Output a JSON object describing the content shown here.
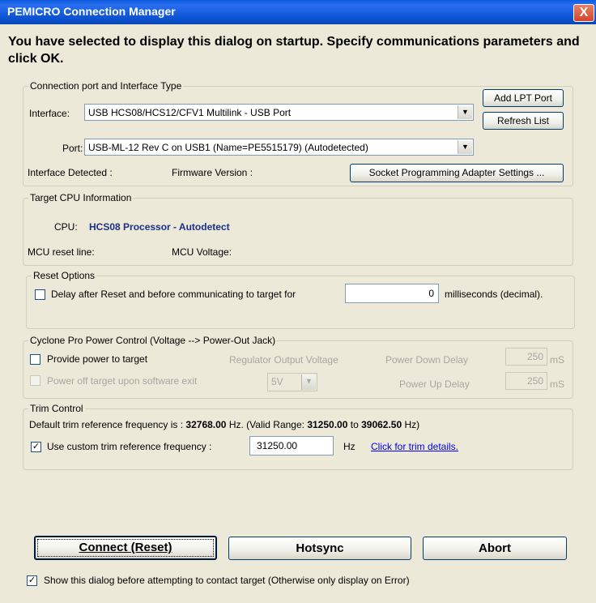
{
  "window": {
    "title": "PEMICRO Connection Manager",
    "close_glyph": "X"
  },
  "intro_text": "You have selected to display this dialog on startup. Specify communications parameters and click OK.",
  "connection": {
    "legend": "Connection port and Interface Type",
    "interface_label": "Interface:",
    "interface_value": "USB HCS08/HCS12/CFV1 Multilink - USB Port",
    "port_label": "Port:",
    "port_value": "USB-ML-12 Rev C on USB1 (Name=PE5515179) (Autodetected)",
    "add_lpt_label": "Add LPT Port",
    "refresh_label": "Refresh List",
    "interface_detected_label": "Interface Detected :",
    "firmware_label": "Firmware Version :",
    "socket_button_label": "Socket Programming Adapter Settings ..."
  },
  "target_cpu": {
    "legend": "Target CPU Information",
    "cpu_label": "CPU:",
    "cpu_value": "HCS08 Processor - Autodetect",
    "reset_line_label": "MCU reset line:",
    "voltage_label": "MCU Voltage:"
  },
  "reset_options": {
    "legend": "Reset Options",
    "delay_label": "Delay after Reset and before communicating to target for",
    "delay_value": "0",
    "delay_unit": "milliseconds (decimal)."
  },
  "power_control": {
    "legend": "Cyclone Pro Power Control  (Voltage --> Power-Out Jack)",
    "provide_power_label": "Provide power to target",
    "regulator_label": "Regulator Output Voltage",
    "power_down_label": "Power Down Delay",
    "power_down_value": "250",
    "power_down_unit": "mS",
    "power_off_label": "Power off target upon software exit",
    "voltage_value": "5V",
    "power_up_label": "Power Up Delay",
    "power_up_value": "250",
    "power_up_unit": "mS"
  },
  "trim": {
    "legend": "Trim Control",
    "default_prefix": "Default trim reference frequency is :",
    "default_value": "32768.00",
    "hz_valid_prefix": "Hz. (Valid Range:",
    "range_min": "31250.00",
    "range_to": "to",
    "range_max": "39062.50",
    "range_suffix": "Hz)",
    "custom_label": "Use custom trim reference frequency :",
    "custom_value": "31250.00",
    "custom_unit": "Hz",
    "details_link": "Click for trim details.",
    "custom_checked": "✓"
  },
  "buttons": {
    "connect_label": "Connect (Reset)",
    "hotsync_label": "Hotsync",
    "abort_label": "Abort"
  },
  "footer": {
    "show_dialog_label": "Show this dialog before attempting to contact target (Otherwise only display on Error)",
    "show_dialog_checked": "✓"
  },
  "icons": {
    "dropdown": "chevron-down-icon",
    "close": "close-icon"
  },
  "colors": {
    "titlebar": "#0a5be0",
    "cpu_text": "#1b2f8a",
    "link": "#0000ee",
    "background": "#ece9d8"
  }
}
